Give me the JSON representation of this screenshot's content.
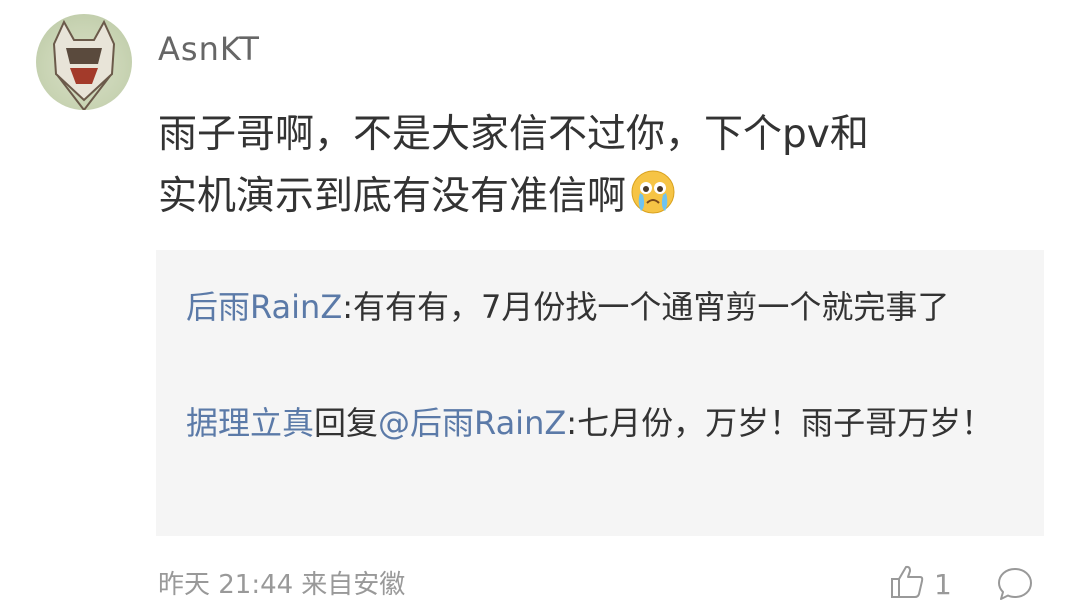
{
  "comment": {
    "username": "AsnKT",
    "text_line1": "雨子哥啊，不是大家信不过你，下个pv和",
    "text_line2": "实机演示到底有没有准信啊",
    "emoji": "crying-face"
  },
  "replies": [
    {
      "user": "后雨RainZ",
      "separator": ":",
      "text": "有有有，7月份找一个通宵剪一个就完事了"
    },
    {
      "user": "据理立真",
      "reply_word": "回复",
      "mention": "@后雨RainZ",
      "separator": ":",
      "text": "七月份，万岁！雨子哥万岁！"
    }
  ],
  "footer": {
    "time": "昨天 21:44",
    "location": "来自安徽",
    "like_count": "1"
  },
  "colors": {
    "link": "#5b7aa8",
    "meta": "#999999",
    "reply_bg": "#f5f5f5"
  }
}
